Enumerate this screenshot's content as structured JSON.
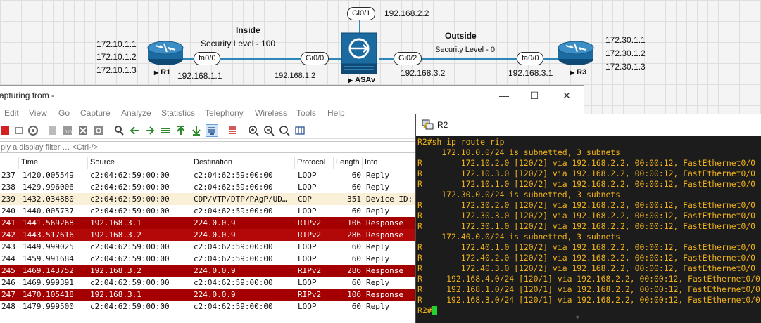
{
  "topology": {
    "inside_label": "Inside",
    "inside_security": "Security Level - 100",
    "outside_label": "Outside",
    "outside_security": "Security Level - 0",
    "r1": {
      "name": "R1",
      "loopbacks": [
        "172.10.1.1",
        "172.10.1.2",
        "172.10.1.3"
      ],
      "iface": "fa0/0",
      "ip": "192.168.1.1"
    },
    "asav": {
      "name": "ASAv",
      "iface_inside": "Gi0/0",
      "ip_inside": "192.168.1.2",
      "iface_outside": "Gi0/2",
      "ip_outside": "192.168.3.2",
      "iface_top": "Gi0/1",
      "ip_top": "192.168.2.2"
    },
    "r3": {
      "name": "R3",
      "loopbacks": [
        "172.30.1.1",
        "172.30.1.2",
        "172.30.1.3"
      ],
      "iface": "fa0/0",
      "ip": "192.168.3.1"
    },
    "link_color": "#2f86b8"
  },
  "wireshark": {
    "title": "apturing from -",
    "controls": [
      "—",
      "☐",
      "✕"
    ],
    "menu": [
      "Edit",
      "View",
      "Go",
      "Capture",
      "Analyze",
      "Statistics",
      "Telephony",
      "Wireless",
      "Tools",
      "Help"
    ],
    "filter_placeholder": "ply a display filter … <Ctrl-/>",
    "columns": [
      "Time",
      "Source",
      "Destination",
      "Protocol",
      "Length",
      "Info"
    ],
    "rows": [
      {
        "no": "237",
        "time": "1420.005549",
        "src": "c2:04:62:59:00:00",
        "dst": "c2:04:62:59:00:00",
        "proto": "LOOP",
        "len": "60",
        "info": "Reply",
        "style": "normal"
      },
      {
        "no": "238",
        "time": "1429.996006",
        "src": "c2:04:62:59:00:00",
        "dst": "c2:04:62:59:00:00",
        "proto": "LOOP",
        "len": "60",
        "info": "Reply",
        "style": "normal"
      },
      {
        "no": "239",
        "time": "1432.034880",
        "src": "c2:04:62:59:00:00",
        "dst": "CDP/VTP/DTP/PAgP/UD…",
        "proto": "CDP",
        "len": "351",
        "info": "Device ID:",
        "style": "highlight"
      },
      {
        "no": "240",
        "time": "1440.005737",
        "src": "c2:04:62:59:00:00",
        "dst": "c2:04:62:59:00:00",
        "proto": "LOOP",
        "len": "60",
        "info": "Reply",
        "style": "normal"
      },
      {
        "no": "241",
        "time": "1441.569268",
        "src": "192.168.3.1",
        "dst": "224.0.0.9",
        "proto": "RIPv2",
        "len": "106",
        "info": "Response",
        "style": "rip"
      },
      {
        "no": "242",
        "time": "1443.517616",
        "src": "192.168.3.2",
        "dst": "224.0.0.9",
        "proto": "RIPv2",
        "len": "286",
        "info": "Response",
        "style": "rip alt"
      },
      {
        "no": "243",
        "time": "1449.999025",
        "src": "c2:04:62:59:00:00",
        "dst": "c2:04:62:59:00:00",
        "proto": "LOOP",
        "len": "60",
        "info": "Reply",
        "style": "normal"
      },
      {
        "no": "244",
        "time": "1459.991684",
        "src": "c2:04:62:59:00:00",
        "dst": "c2:04:62:59:00:00",
        "proto": "LOOP",
        "len": "60",
        "info": "Reply",
        "style": "normal"
      },
      {
        "no": "245",
        "time": "1469.143752",
        "src": "192.168.3.2",
        "dst": "224.0.0.9",
        "proto": "RIPv2",
        "len": "286",
        "info": "Response",
        "style": "rip"
      },
      {
        "no": "246",
        "time": "1469.999391",
        "src": "c2:04:62:59:00:00",
        "dst": "c2:04:62:59:00:00",
        "proto": "LOOP",
        "len": "60",
        "info": "Reply",
        "style": "normal"
      },
      {
        "no": "247",
        "time": "1470.105418",
        "src": "192.168.3.1",
        "dst": "224.0.0.9",
        "proto": "RIPv2",
        "len": "106",
        "info": "Response",
        "style": "rip"
      },
      {
        "no": "248",
        "time": "1479.999500",
        "src": "c2:04:62:59:00:00",
        "dst": "c2:04:62:59:00:00",
        "proto": "LOOP",
        "len": "60",
        "info": "Reply",
        "style": "normal"
      }
    ],
    "rip_row_color": "#a40000",
    "highlight_row_color": "#faf0d7"
  },
  "terminal": {
    "title": "R2",
    "text_color": "#f0b21a",
    "lines": [
      "R2#sh ip route rip",
      "     172.10.0.0/24 is subnetted, 3 subnets",
      "R        172.10.2.0 [120/2] via 192.168.2.2, 00:00:12, FastEthernet0/0",
      "R        172.10.3.0 [120/2] via 192.168.2.2, 00:00:12, FastEthernet0/0",
      "R        172.10.1.0 [120/2] via 192.168.2.2, 00:00:12, FastEthernet0/0",
      "     172.30.0.0/24 is subnetted, 3 subnets",
      "R        172.30.2.0 [120/2] via 192.168.2.2, 00:00:12, FastEthernet0/0",
      "R        172.30.3.0 [120/2] via 192.168.2.2, 00:00:12, FastEthernet0/0",
      "R        172.30.1.0 [120/2] via 192.168.2.2, 00:00:12, FastEthernet0/0",
      "     172.40.0.0/24 is subnetted, 3 subnets",
      "R        172.40.1.0 [120/2] via 192.168.2.2, 00:00:12, FastEthernet0/0",
      "R        172.40.2.0 [120/2] via 192.168.2.2, 00:00:12, FastEthernet0/0",
      "R        172.40.3.0 [120/2] via 192.168.2.2, 00:00:12, FastEthernet0/0",
      "R     192.168.4.0/24 [120/1] via 192.168.2.2, 00:00:12, FastEthernet0/0",
      "R     192.168.1.0/24 [120/1] via 192.168.2.2, 00:00:12, FastEthernet0/0",
      "R     192.168.3.0/24 [120/1] via 192.168.2.2, 00:00:12, FastEthernet0/0",
      "R2#"
    ]
  }
}
